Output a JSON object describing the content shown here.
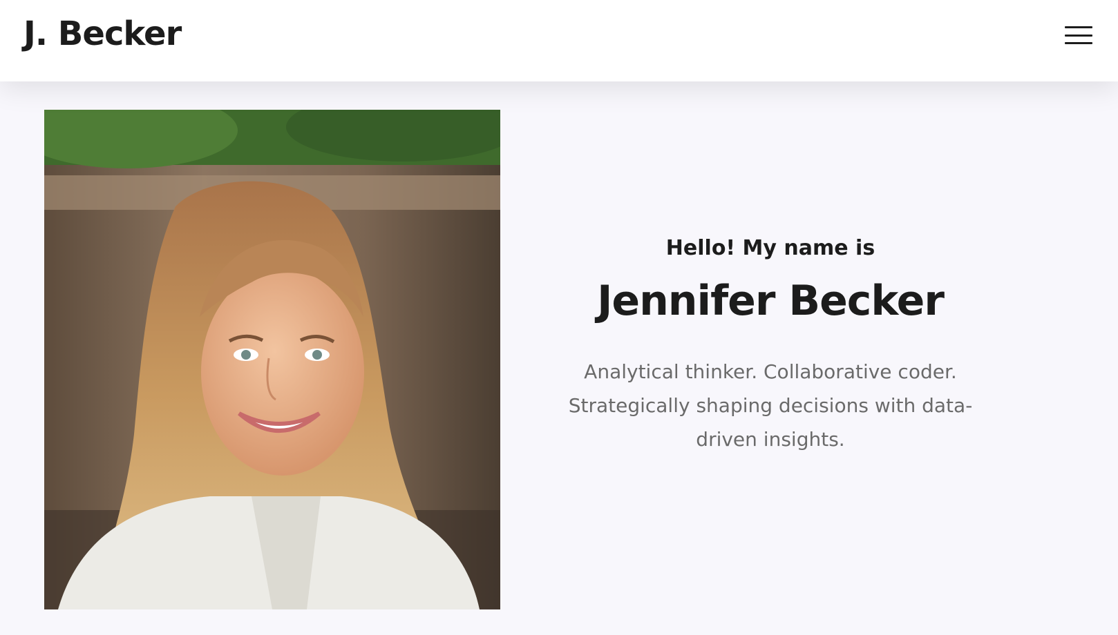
{
  "header": {
    "brand": "J. Becker",
    "menu_icon": "hamburger-menu-icon"
  },
  "hero": {
    "portrait_icon": "portrait-photo",
    "greeting": "Hello! My name is",
    "name": "Jennifer Becker",
    "tagline_lines": [
      "Analytical thinker. Collaborative coder.",
      "Strategically shaping decisions with data-",
      "driven insights."
    ]
  },
  "colors": {
    "page_background": "#f8f7fc",
    "header_background": "#ffffff",
    "heading_text": "#1c1c1c",
    "body_text": "#6a6a6a"
  }
}
